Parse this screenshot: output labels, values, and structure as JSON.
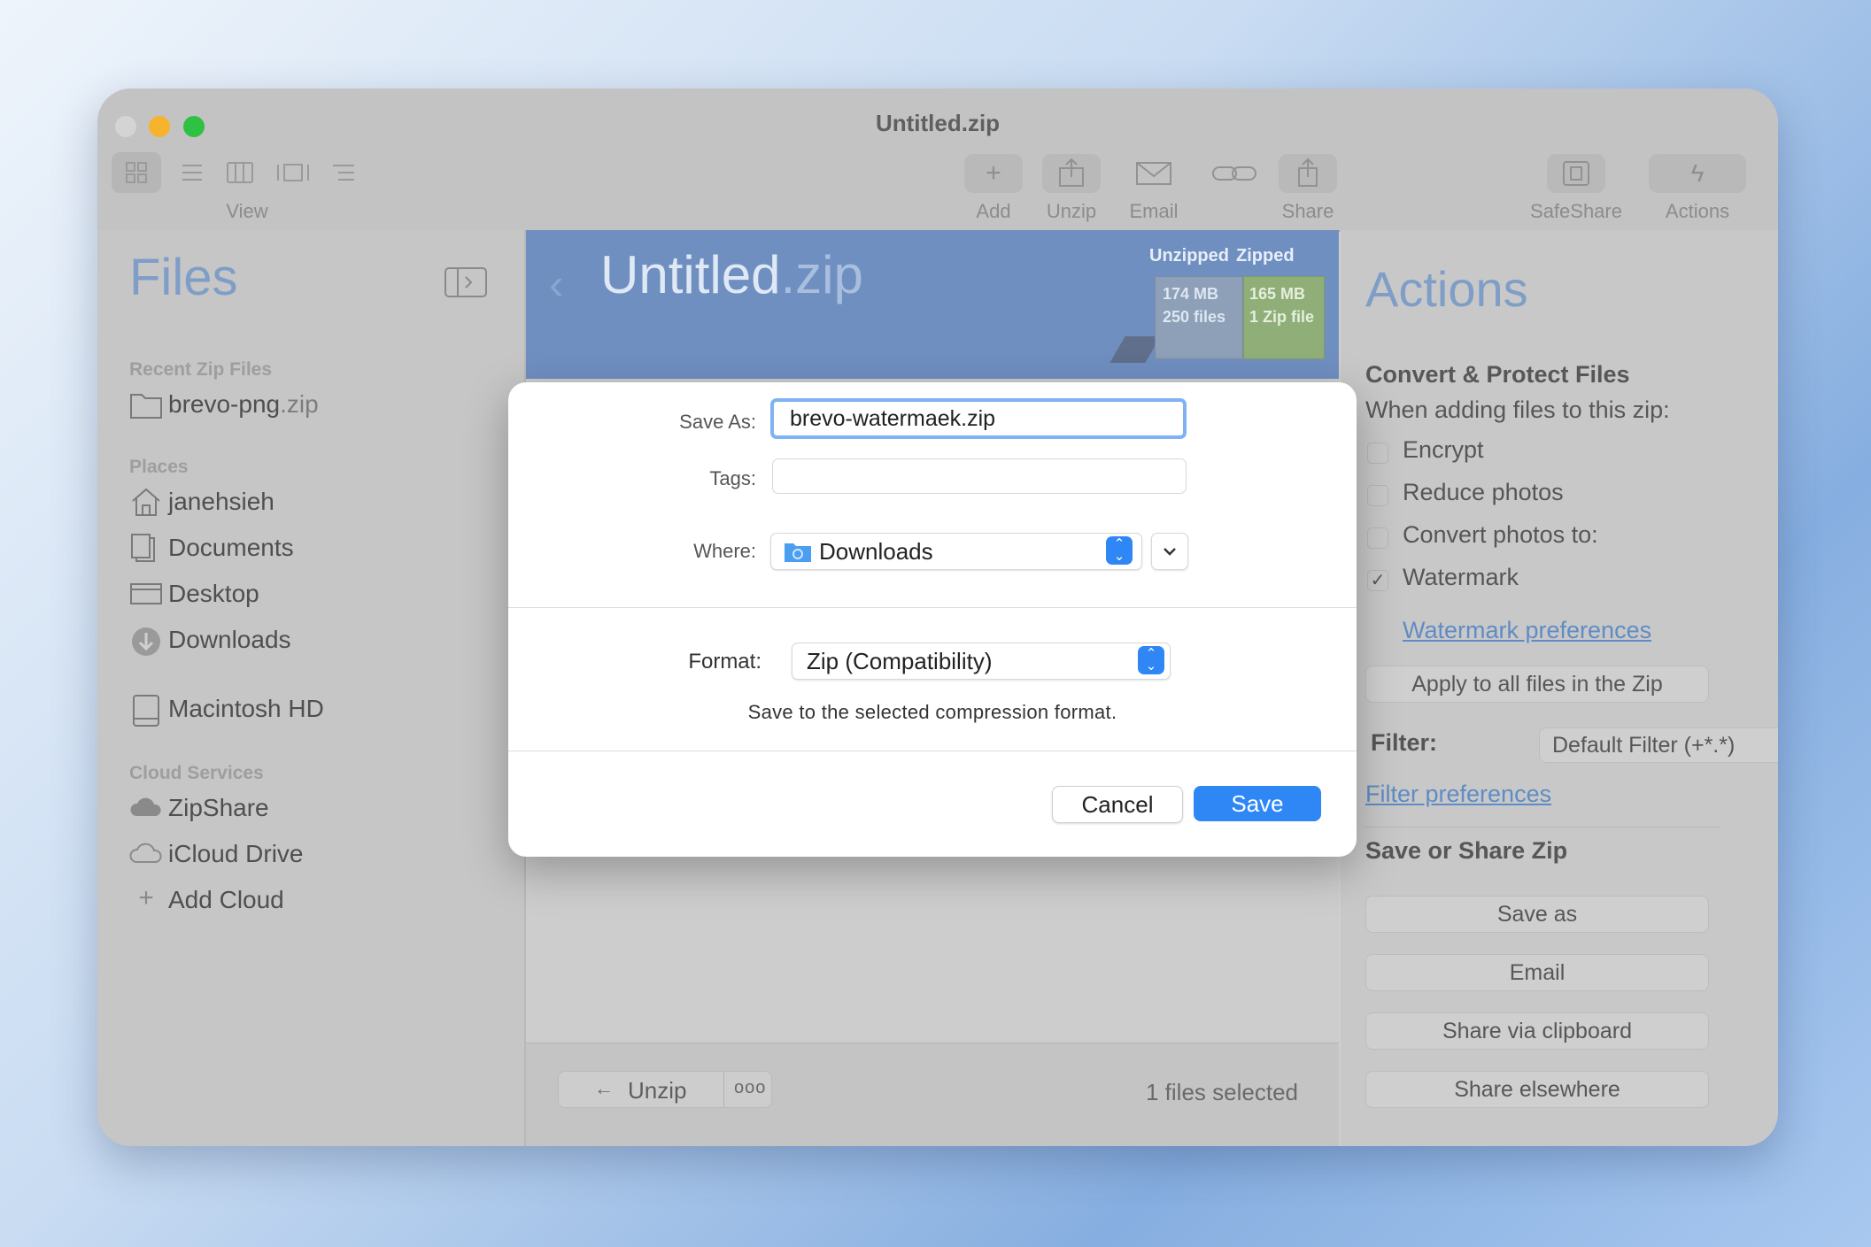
{
  "window": {
    "title": "Untitled.zip"
  },
  "toolbar": {
    "view_label": "View",
    "buttons": [
      {
        "label": "Add",
        "icon": "plus-icon"
      },
      {
        "label": "Unzip",
        "icon": "unzip-icon"
      },
      {
        "label": "Email",
        "icon": "envelope-icon"
      },
      {
        "label": "Share",
        "icon": "share-icon"
      },
      {
        "label": "SafeShare",
        "icon": "safeshare-icon"
      },
      {
        "label": "Actions",
        "icon": "lightning-icon"
      }
    ]
  },
  "sidebar": {
    "title": "Files",
    "recent_heading": "Recent Zip Files",
    "recent_item_name": "brevo-png",
    "recent_item_ext": ".zip",
    "places_heading": "Places",
    "places": [
      "janehsieh",
      "Documents",
      "Desktop",
      "Downloads",
      "Macintosh HD"
    ],
    "cloud_heading": "Cloud Services",
    "cloud": [
      "ZipShare",
      "iCloud Drive",
      "Add Cloud"
    ]
  },
  "banner": {
    "title_name": "Untitled",
    "title_ext": ".zip",
    "unzipped_label": "Unzipped",
    "zipped_label": "Zipped",
    "unzipped_size": "174 MB",
    "unzipped_count": "250 files",
    "zipped_size": "165 MB",
    "zipped_count": "1 Zip file"
  },
  "bottom": {
    "unzip_label": "Unzip",
    "more_label": "ooo",
    "status": "1 files selected"
  },
  "actions": {
    "title": "Actions",
    "convert_heading": "Convert & Protect Files",
    "convert_sub": "When adding files to this zip:",
    "options": [
      {
        "label": "Encrypt",
        "checked": false
      },
      {
        "label": "Reduce photos",
        "checked": false
      },
      {
        "label": "Convert photos to:",
        "checked": false
      },
      {
        "label": "Watermark",
        "checked": true
      }
    ],
    "checkmark": "✓",
    "watermark_link": "Watermark preferences",
    "apply_button": "Apply to all files in the Zip",
    "filter_label": "Filter:",
    "filter_value": "Default Filter (+*.*)",
    "filter_link": "Filter preferences",
    "save_heading": "Save or Share Zip",
    "save_buttons": [
      "Save as",
      "Email",
      "Share via clipboard",
      "Share elsewhere"
    ]
  },
  "dialog": {
    "save_as_label": "Save As:",
    "save_as_value": "brevo-watermaek.zip",
    "tags_label": "Tags:",
    "tags_value": "",
    "where_label": "Where:",
    "where_value": "Downloads",
    "format_label": "Format:",
    "format_value": "Zip (Compatibility)",
    "format_hint": "Save to the selected compression format.",
    "cancel_label": "Cancel",
    "save_label": "Save"
  },
  "colors": {
    "accent": "#2f87f5",
    "banner": "#6f8fc0",
    "close": "#d4d4d4",
    "minimize": "#f6b32b",
    "zoom": "#2fc141"
  }
}
